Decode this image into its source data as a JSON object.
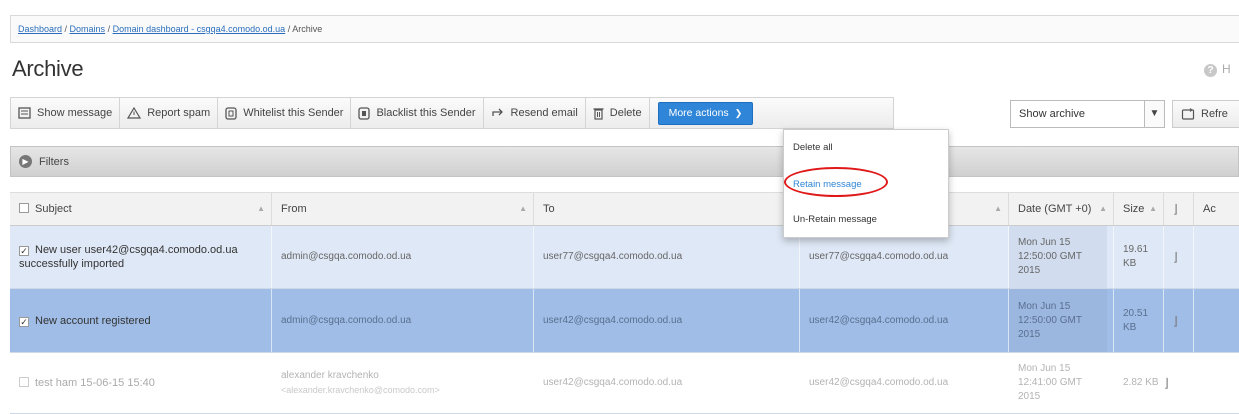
{
  "breadcrumb": {
    "items": [
      "Dashboard",
      "Domains",
      "Domain dashboard - csgqa4.comodo.od.ua"
    ],
    "current": "Archive"
  },
  "page": {
    "title": "Archive",
    "help_label": "H"
  },
  "toolbar": {
    "show_message": "Show message",
    "report_spam": "Report spam",
    "whitelist": "Whitelist this Sender",
    "blacklist": "Blacklist this Sender",
    "resend": "Resend email",
    "delete": "Delete",
    "more_actions": "More actions"
  },
  "archive_select": {
    "value": "Show archive"
  },
  "refresh": {
    "label": "Refre"
  },
  "filters": {
    "label": "Filters"
  },
  "dropdown": {
    "delete_all": "Delete all",
    "retain": "Retain message",
    "unretain": "Un-Retain message"
  },
  "table": {
    "headers": {
      "subject": "Subject",
      "from": "From",
      "to": "To",
      "date": "Date (GMT +0)",
      "size": "Size",
      "actions": "Ac"
    },
    "rows": [
      {
        "checked": true,
        "subject": "New user user42@csgqa4.comodo.od.ua successfully imported",
        "from": "admin@csgqa.comodo.od.ua",
        "to": "user77@csgqa4.comodo.od.ua",
        "recipient": "user77@csgqa4.comodo.od.ua",
        "date": "Mon Jun 15 12:50:00 GMT 2015",
        "size": "19.61 KB"
      },
      {
        "checked": true,
        "subject": "New account registered",
        "from": "admin@csgqa.comodo.od.ua",
        "to": "user42@csgqa4.comodo.od.ua",
        "recipient": "user42@csgqa4.comodo.od.ua",
        "date": "Mon Jun 15 12:50:00 GMT 2015",
        "size": "20.51 KB"
      },
      {
        "checked": false,
        "subject": "test ham 15-06-15 15:40",
        "from": "alexander kravchenko",
        "from_email": "<alexander.kravchenko@comodo.com>",
        "to": "user42@csgqa4.comodo.od.ua",
        "recipient": "user42@csgqa4.comodo.od.ua",
        "date": "Mon Jun 15 12:41:00 GMT 2015",
        "size": "2.82 KB"
      }
    ]
  },
  "colors": {
    "accent": "#2f86d8",
    "selected_row": "#9fbde6",
    "hover_row": "#dfe8f6",
    "highlight_circle": "#e01818"
  }
}
